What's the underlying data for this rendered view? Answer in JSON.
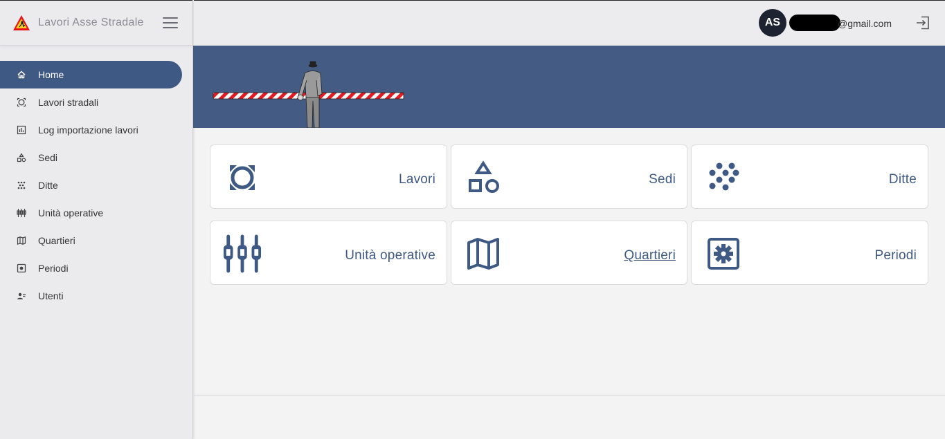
{
  "app": {
    "title": "Lavori Asse Stradale"
  },
  "user": {
    "initials": "AS",
    "email_visible": "@gmail.com"
  },
  "colors": {
    "accent": "#3f5985",
    "banner": "#445b83",
    "avatar": "#1d2330"
  },
  "sidebar": {
    "items": [
      {
        "label": "Home",
        "icon": "home-icon",
        "active": true
      },
      {
        "label": "Lavori stradali",
        "icon": "road-work-icon",
        "active": false
      },
      {
        "label": "Log importazione lavori",
        "icon": "chart-log-icon",
        "active": false
      },
      {
        "label": "Sedi",
        "icon": "shapes-icon",
        "active": false
      },
      {
        "label": "Ditte",
        "icon": "dots-grid-icon",
        "active": false
      },
      {
        "label": "Unità operative",
        "icon": "sliders-icon",
        "active": false
      },
      {
        "label": "Quartieri",
        "icon": "map-icon",
        "active": false
      },
      {
        "label": "Periodi",
        "icon": "settings-box-icon",
        "active": false
      },
      {
        "label": "Utenti",
        "icon": "users-icon",
        "active": false
      }
    ]
  },
  "cards": [
    {
      "label": "Lavori",
      "icon": "road-work-icon"
    },
    {
      "label": "Sedi",
      "icon": "shapes-icon"
    },
    {
      "label": "Ditte",
      "icon": "dots-grid-icon"
    },
    {
      "label": "Unità operative",
      "icon": "sliders-icon"
    },
    {
      "label": "Quartieri",
      "icon": "map-icon",
      "hovered": true
    },
    {
      "label": "Periodi",
      "icon": "settings-box-icon"
    }
  ]
}
